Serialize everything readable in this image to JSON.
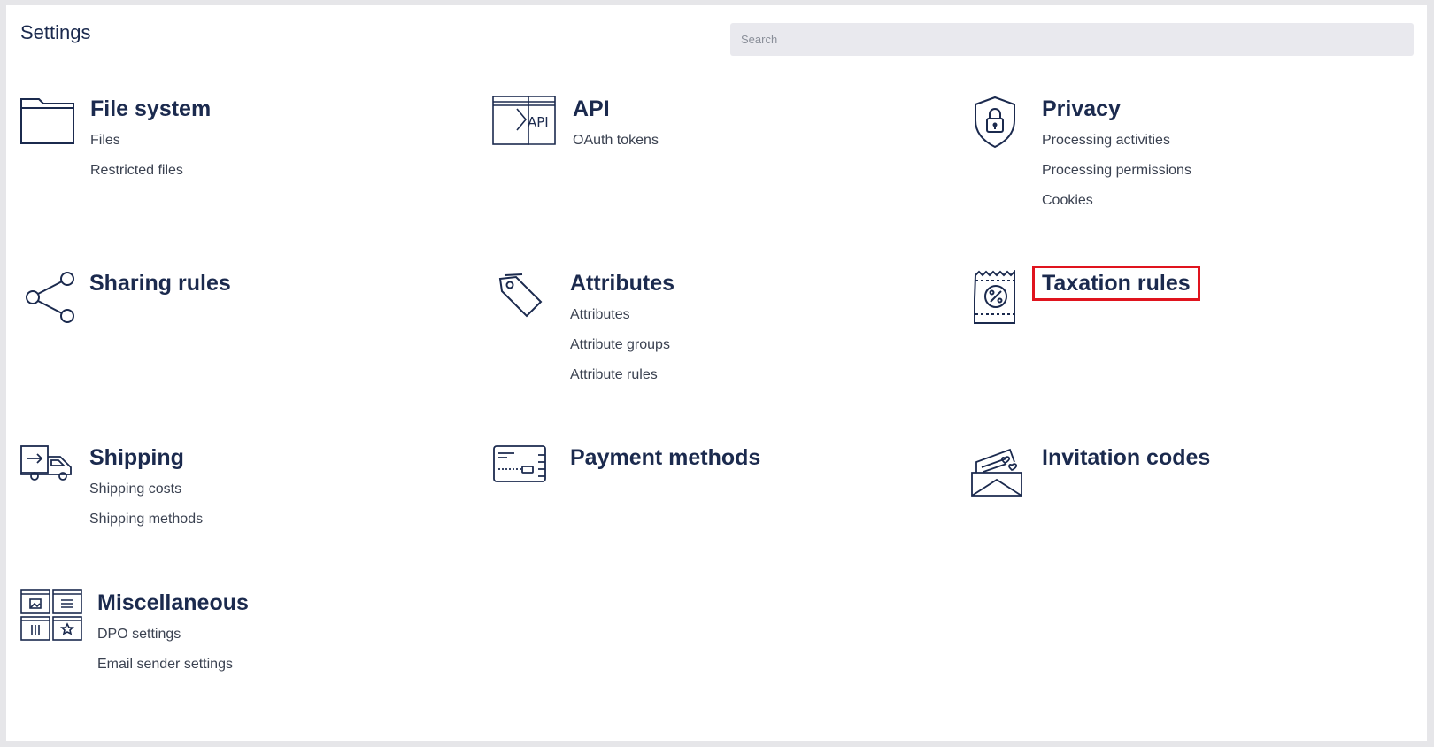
{
  "header": {
    "title": "Settings",
    "search_placeholder": "Search"
  },
  "sections": [
    {
      "title": "File system",
      "icon": "folder-icon",
      "items": [
        "Files",
        "Restricted files"
      ]
    },
    {
      "title": "API",
      "icon": "api-icon",
      "items": [
        "OAuth tokens"
      ]
    },
    {
      "title": "Privacy",
      "icon": "shield-lock-icon",
      "items": [
        "Processing activities",
        "Processing permissions",
        "Cookies"
      ]
    },
    {
      "title": "Sharing rules",
      "icon": "share-icon",
      "items": []
    },
    {
      "title": "Attributes",
      "icon": "tag-icon",
      "items": [
        "Attributes",
        "Attribute groups",
        "Attribute rules"
      ]
    },
    {
      "title": "Taxation rules",
      "icon": "tax-receipt-icon",
      "items": [],
      "highlighted": true
    },
    {
      "title": "Shipping",
      "icon": "delivery-truck-icon",
      "items": [
        "Shipping costs",
        "Shipping methods"
      ]
    },
    {
      "title": "Payment methods",
      "icon": "credit-card-icon",
      "items": []
    },
    {
      "title": "Invitation codes",
      "icon": "invitation-envelope-icon",
      "items": []
    },
    {
      "title": "Miscellaneous",
      "icon": "widgets-grid-icon",
      "items": [
        "DPO settings",
        "Email sender settings"
      ]
    }
  ],
  "colors": {
    "text": "#1b2a4e",
    "highlight": "#e0141e",
    "search_bg": "#e9e9ee"
  }
}
